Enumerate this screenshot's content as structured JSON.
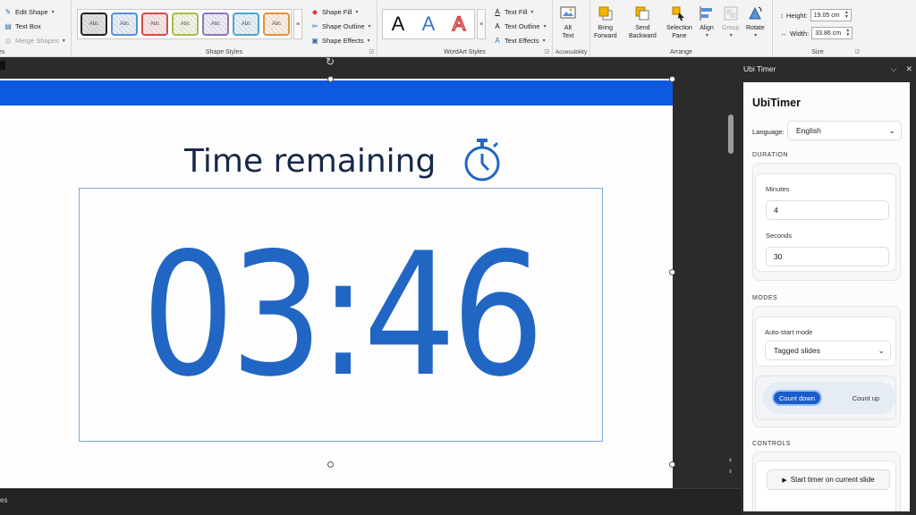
{
  "ribbon": {
    "insert_shapes": {
      "edit_shape": "Edit Shape",
      "text_box": "Text Box",
      "merge_shapes": "Merge Shapes",
      "group_label": "es"
    },
    "shape_styles": {
      "gallery_text": "Abc",
      "style_colors": [
        "#222222",
        "#5b8fd8",
        "#d84a4a",
        "#a7bd4c",
        "#8c77b8",
        "#4ba6c9",
        "#e88f3d"
      ],
      "shape_fill": "Shape Fill",
      "shape_outline": "Shape Outline",
      "shape_effects": "Shape Effects",
      "group_label": "Shape Styles"
    },
    "wordart": {
      "letter": "A",
      "text_fill": "Text Fill",
      "text_outline": "Text Outline",
      "text_effects": "Text Effects",
      "group_label": "WordArt Styles"
    },
    "accessibility": {
      "alt_text_1": "Alt",
      "alt_text_2": "Text",
      "group_label": "Accessibility"
    },
    "arrange": {
      "bring_forward_1": "Bring",
      "bring_forward_2": "Forward",
      "send_backward_1": "Send",
      "send_backward_2": "Backward",
      "selection_pane_1": "Selection",
      "selection_pane_2": "Pane",
      "align": "Align",
      "group": "Group",
      "rotate": "Rotate",
      "group_label": "Arrange"
    },
    "size": {
      "height_label": "Height:",
      "height_value": "19.05 cm",
      "width_label": "Width:",
      "width_value": "33.86 cm",
      "group_label": "Size"
    }
  },
  "slide": {
    "title": "Time remaining",
    "time": "03:46",
    "bar_color": "#0d5ae0",
    "digit_color": "#2266c4"
  },
  "status": {
    "text": "es"
  },
  "pane": {
    "header_title": "Ubi Timer",
    "app_title": "UbiTimer",
    "language_label": "Language:",
    "language_value": "English",
    "duration_title": "DURATION",
    "minutes_label": "Minutes",
    "minutes_value": "4",
    "seconds_label": "Seconds",
    "seconds_value": "30",
    "modes_title": "MODES",
    "auto_start_label": "Auto-start mode",
    "auto_start_value": "Tagged slides",
    "count_down": "Count down",
    "count_up": "Count up",
    "controls_title": "CONTROLS",
    "start_button": "Start timer on current slide",
    "accent_color": "#1a5ccc"
  }
}
